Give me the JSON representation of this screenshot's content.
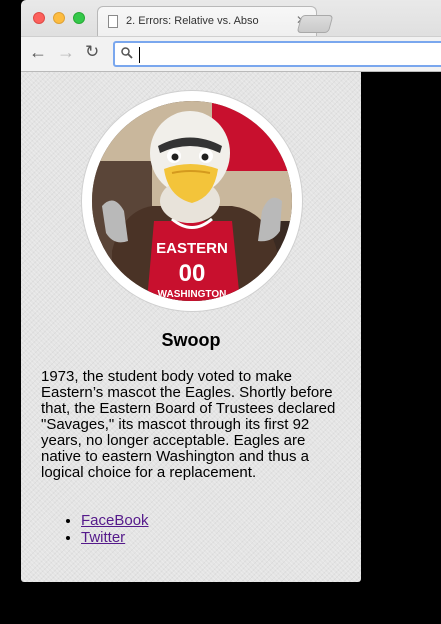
{
  "browser": {
    "tab_title": "2. Errors: Relative vs. Abso",
    "tab_close": "✕",
    "address_value": "",
    "icons": {
      "back": "back-arrow-icon",
      "forward": "forward-arrow-icon",
      "reload": "reload-icon",
      "search": "search-icon"
    }
  },
  "profile": {
    "name": "Swoop",
    "image_alt": "Eastern Washington eagle mascot in red jersey number 00",
    "jersey_text_top": "EASTERN",
    "jersey_number": "00",
    "jersey_text_bottom": "WASHINGTON",
    "bio": "1973, the student body voted to make Eastern’s mascot the Eagles. Shortly before that, the Eastern Board of Trustees declared \"Savages,\" its mascot through its first 92 years, no longer acceptable. Eagles are native to eastern Washington and thus a logical choice for a replacement.",
    "links": [
      {
        "label": "FaceBook"
      },
      {
        "label": "Twitter"
      }
    ]
  },
  "colors": {
    "link_visited": "#551a8b",
    "jersey_red": "#c8102e"
  }
}
